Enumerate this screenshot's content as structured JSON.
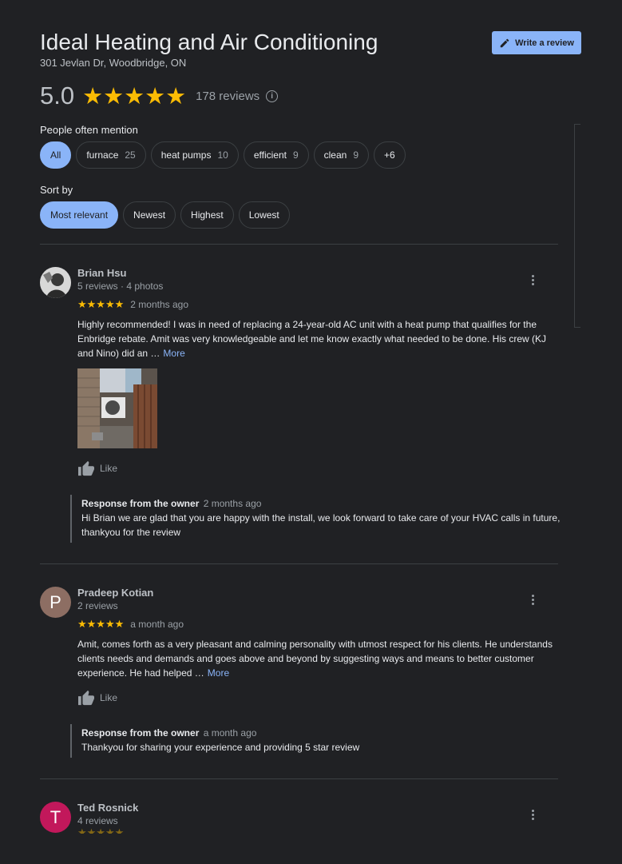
{
  "header": {
    "title": "Ideal Heating and Air Conditioning",
    "address": "301 Jevlan Dr, Woodbridge, ON",
    "write_review_label": "Write a review",
    "rating": "5.0",
    "stars": "★★★★★",
    "review_count": "178 reviews",
    "info_glyph": "i"
  },
  "mentions": {
    "label": "People often mention",
    "chips": [
      {
        "label": "All",
        "count": ""
      },
      {
        "label": "furnace",
        "count": "25"
      },
      {
        "label": "heat pumps",
        "count": "10"
      },
      {
        "label": "efficient",
        "count": "9"
      },
      {
        "label": "clean",
        "count": "9"
      },
      {
        "label": "+6",
        "count": ""
      }
    ]
  },
  "sort": {
    "label": "Sort by",
    "options": [
      "Most relevant",
      "Newest",
      "Highest",
      "Lowest"
    ],
    "selected": "Most relevant"
  },
  "reviews": [
    {
      "name": "Brian Hsu",
      "meta": "5 reviews · 4 photos",
      "stars": "★★★★★",
      "when": "2 months ago",
      "text": "Highly recommended! I was in need of replacing a 24-year-old AC unit with a heat pump that qualifies for the Enbridge rebate. Amit was very knowledgeable and let me know exactly what needed to be done. His crew (KJ and Nino) did an …",
      "more": "More",
      "like": "Like",
      "owner_label": "Response from the owner",
      "owner_when": "2 months ago",
      "owner_text": "Hi Brian we are glad that you are happy with the install, we look forward to take care of your HVAC calls in future, thankyou for the review"
    },
    {
      "name": "Pradeep Kotian",
      "avatar_letter": "P",
      "avatar_color": "#8d6e63",
      "meta": "2 reviews",
      "stars": "★★★★★",
      "when": "a month ago",
      "text": "Amit, comes forth as a very pleasant and calming personality with utmost respect for his clients. He understands clients needs and demands and goes above and beyond by suggesting ways and means to better customer experience. He had helped …",
      "more": "More",
      "like": "Like",
      "owner_label": "Response from the owner",
      "owner_when": "a month ago",
      "owner_text": "Thankyou for sharing your experience and providing 5 star review"
    },
    {
      "name": "Ted Rosnick",
      "avatar_letter": "T",
      "avatar_color": "#c2185b",
      "meta": "4 reviews",
      "stars": "★★★★★"
    }
  ],
  "colors": {
    "background": "#202124",
    "accent": "#8ab4f8",
    "star": "#fbbc04"
  }
}
